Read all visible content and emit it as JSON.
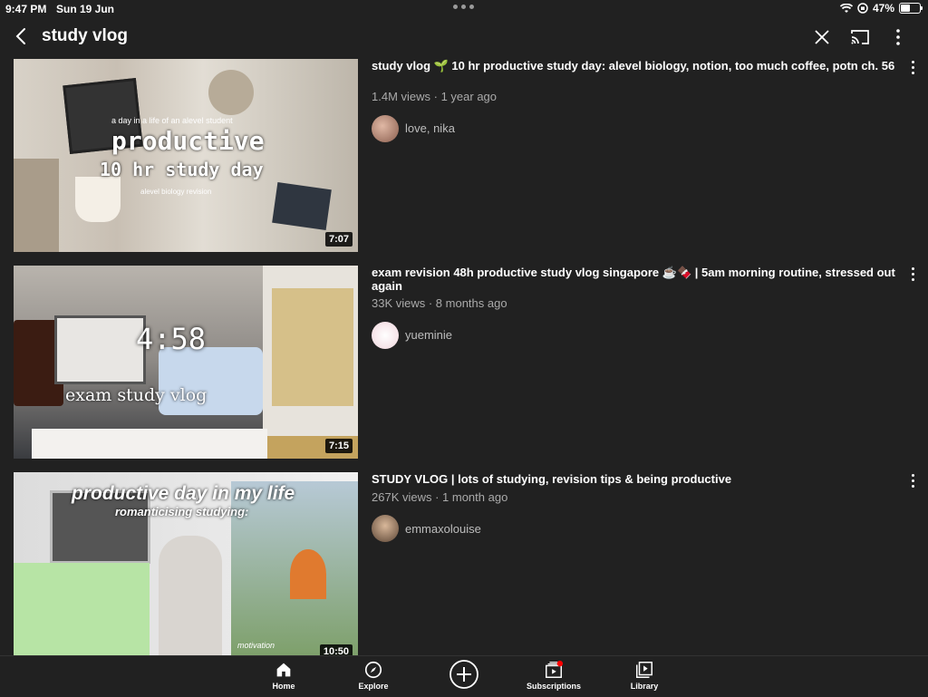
{
  "status": {
    "time": "9:47 PM",
    "date": "Sun 19 Jun",
    "battery": "47%"
  },
  "search": {
    "query": "study vlog"
  },
  "videos": [
    {
      "title": "study vlog 🌱 10 hr productive study day: alevel biology, notion, too much coffee, potn ch. 56",
      "meta": "1.4M views · 1 year ago",
      "channel": "love, nika",
      "duration": "7:07",
      "overlay": [
        "a day in a life of an alevel student",
        "productive",
        "10 hr study day",
        "alevel biology revision"
      ]
    },
    {
      "title": "exam revision 48h productive study vlog singapore ☕🍫 | 5am morning routine, stressed out again",
      "meta": "33K views · 8 months ago",
      "channel": "yueminie",
      "duration": "7:15",
      "overlay": [
        "4:58",
        "exam study vlog"
      ]
    },
    {
      "title": "STUDY VLOG | lots of studying, revision tips & being productive",
      "meta": "267K views · 1 month ago",
      "channel": "emmaxolouise",
      "duration": "10:50",
      "overlay": [
        "productive day in my life",
        "romanticising studying:",
        "motivation"
      ]
    }
  ],
  "nav": {
    "home": "Home",
    "explore": "Explore",
    "subscriptions": "Subscriptions",
    "library": "Library"
  },
  "colors": {
    "background": "#212121",
    "notification": "#ff0000"
  }
}
